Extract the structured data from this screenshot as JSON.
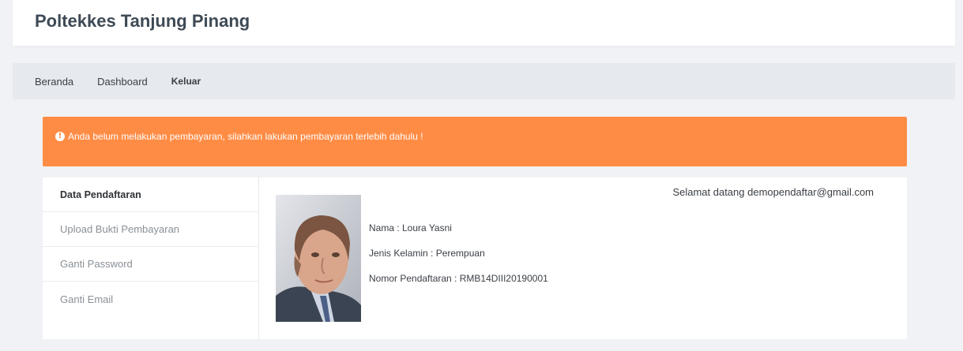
{
  "header": {
    "brand": "Poltekkes Tanjung Pinang"
  },
  "nav": {
    "items": [
      "Beranda",
      "Dashboard",
      "Keluar"
    ]
  },
  "alert": {
    "message": "Anda belum melakukan pembayaran, silahkan lakukan pembayaran terlebih dahulu !"
  },
  "sidebar": {
    "items": [
      "Data Pendaftaran",
      "Upload Bukti Pembayaran",
      "Ganti Password",
      "Ganti Email"
    ]
  },
  "main": {
    "welcome": "Selamat datang demopendaftar@gmail.com",
    "profile": {
      "name": "Nama : Loura Yasni",
      "gender": "Jenis Kelamin : Perempuan",
      "registration": "Nomor Pendaftaran : RMB14DIII20190001"
    }
  },
  "colors": {
    "alert_bg": "#ff8c45",
    "page_bg": "#f1f2f6",
    "navbar_bg": "#e6e9ee"
  }
}
